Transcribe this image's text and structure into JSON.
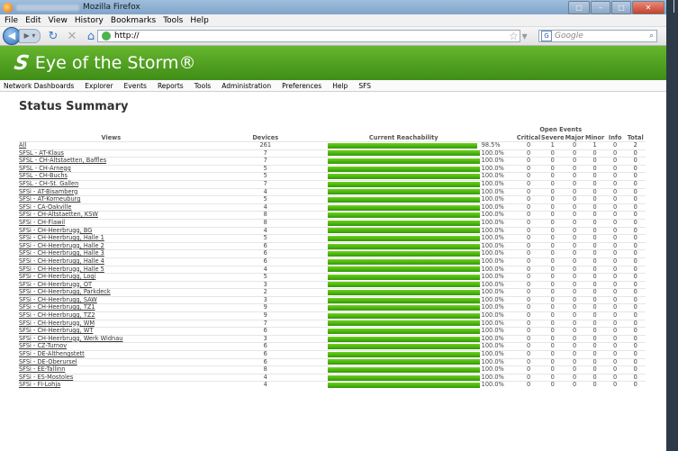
{
  "browser": {
    "title": "Mozilla Firefox",
    "menus": [
      "File",
      "Edit",
      "View",
      "History",
      "Bookmarks",
      "Tools",
      "Help"
    ],
    "url": "http://",
    "search_placeholder": "Google"
  },
  "app": {
    "brand": "Eye of the Storm®",
    "nav": [
      "Network Dashboards",
      "Explorer",
      "Events",
      "Reports",
      "Tools",
      "Administration",
      "Preferences",
      "Help",
      "SFS"
    ]
  },
  "page": {
    "title": "Status Summary"
  },
  "table": {
    "group_header": "Open Events",
    "headers": {
      "views": "Views",
      "devices": "Devices",
      "reach": "Current Reachability",
      "critical": "Critical",
      "severe": "Severe",
      "major": "Major",
      "minor": "Minor",
      "info": "Info",
      "total": "Total"
    },
    "rows": [
      {
        "view": "All",
        "devices": "261",
        "pct": "98.5%",
        "reach": 0.985,
        "critical": "0",
        "severe": "1",
        "major": "0",
        "minor": "1",
        "info": "0",
        "total": "2"
      },
      {
        "view": "SFSL - AT-Klaus",
        "devices": "7",
        "pct": "100.0%",
        "reach": 1,
        "critical": "0",
        "severe": "0",
        "major": "0",
        "minor": "0",
        "info": "0",
        "total": "0"
      },
      {
        "view": "SFSL - CH-Altstaetten, Baffles",
        "devices": "7",
        "pct": "100.0%",
        "reach": 1,
        "critical": "0",
        "severe": "0",
        "major": "0",
        "minor": "0",
        "info": "0",
        "total": "0"
      },
      {
        "view": "SFSL - CH-Arnegg",
        "devices": "5",
        "pct": "100.0%",
        "reach": 1,
        "critical": "0",
        "severe": "0",
        "major": "0",
        "minor": "0",
        "info": "0",
        "total": "0"
      },
      {
        "view": "SFSL - CH-Buchs",
        "devices": "5",
        "pct": "100.0%",
        "reach": 1,
        "critical": "0",
        "severe": "0",
        "major": "0",
        "minor": "0",
        "info": "0",
        "total": "0"
      },
      {
        "view": "SFSL - CH-St. Gallen",
        "devices": "7",
        "pct": "100.0%",
        "reach": 1,
        "critical": "0",
        "severe": "0",
        "major": "0",
        "minor": "0",
        "info": "0",
        "total": "0"
      },
      {
        "view": "SFSi - AT-Bisamberg",
        "devices": "4",
        "pct": "100.0%",
        "reach": 1,
        "critical": "0",
        "severe": "0",
        "major": "0",
        "minor": "0",
        "info": "0",
        "total": "0"
      },
      {
        "view": "SFSi - AT-Korneuburg",
        "devices": "5",
        "pct": "100.0%",
        "reach": 1,
        "critical": "0",
        "severe": "0",
        "major": "0",
        "minor": "0",
        "info": "0",
        "total": "0"
      },
      {
        "view": "SFSi - CA-Oakville",
        "devices": "4",
        "pct": "100.0%",
        "reach": 1,
        "critical": "0",
        "severe": "0",
        "major": "0",
        "minor": "0",
        "info": "0",
        "total": "0"
      },
      {
        "view": "SFSi - CH-Altstaetten, KSW",
        "devices": "8",
        "pct": "100.0%",
        "reach": 1,
        "critical": "0",
        "severe": "0",
        "major": "0",
        "minor": "0",
        "info": "0",
        "total": "0"
      },
      {
        "view": "SFSi - CH-Flawil",
        "devices": "8",
        "pct": "100.0%",
        "reach": 1,
        "critical": "0",
        "severe": "0",
        "major": "0",
        "minor": "0",
        "info": "0",
        "total": "0"
      },
      {
        "view": "SFSi - CH-Heerbrugg, BG",
        "devices": "4",
        "pct": "100.0%",
        "reach": 1,
        "critical": "0",
        "severe": "0",
        "major": "0",
        "minor": "0",
        "info": "0",
        "total": "0"
      },
      {
        "view": "SFSi - CH-Heerbrugg, Halle 1",
        "devices": "5",
        "pct": "100.0%",
        "reach": 1,
        "critical": "0",
        "severe": "0",
        "major": "0",
        "minor": "0",
        "info": "0",
        "total": "0"
      },
      {
        "view": "SFSi - CH-Heerbrugg, Halle 2",
        "devices": "6",
        "pct": "100.0%",
        "reach": 1,
        "critical": "0",
        "severe": "0",
        "major": "0",
        "minor": "0",
        "info": "0",
        "total": "0"
      },
      {
        "view": "SFSi - CH-Heerbrugg, Halle 3",
        "devices": "6",
        "pct": "100.0%",
        "reach": 1,
        "critical": "0",
        "severe": "0",
        "major": "0",
        "minor": "0",
        "info": "0",
        "total": "0"
      },
      {
        "view": "SFSi - CH-Heerbrugg, Halle 4",
        "devices": "6",
        "pct": "100.0%",
        "reach": 1,
        "critical": "0",
        "severe": "0",
        "major": "0",
        "minor": "0",
        "info": "0",
        "total": "0"
      },
      {
        "view": "SFSi - CH-Heerbrugg, Halle 5",
        "devices": "4",
        "pct": "100.0%",
        "reach": 1,
        "critical": "0",
        "severe": "0",
        "major": "0",
        "minor": "0",
        "info": "0",
        "total": "0"
      },
      {
        "view": "SFSi - CH-Heerbrugg, Logi",
        "devices": "5",
        "pct": "100.0%",
        "reach": 1,
        "critical": "0",
        "severe": "0",
        "major": "0",
        "minor": "0",
        "info": "0",
        "total": "0"
      },
      {
        "view": "SFSi - CH-Heerbrugg, OT",
        "devices": "3",
        "pct": "100.0%",
        "reach": 1,
        "critical": "0",
        "severe": "0",
        "major": "0",
        "minor": "0",
        "info": "0",
        "total": "0"
      },
      {
        "view": "SFSi - CH-Heerbrugg, Parkdeck",
        "devices": "2",
        "pct": "100.0%",
        "reach": 1,
        "critical": "0",
        "severe": "0",
        "major": "0",
        "minor": "0",
        "info": "0",
        "total": "0"
      },
      {
        "view": "SFSi - CH-Heerbrugg, SAW",
        "devices": "3",
        "pct": "100.0%",
        "reach": 1,
        "critical": "0",
        "severe": "0",
        "major": "0",
        "minor": "0",
        "info": "0",
        "total": "0"
      },
      {
        "view": "SFSi - CH-Heerbrugg, TZ1",
        "devices": "9",
        "pct": "100.0%",
        "reach": 1,
        "critical": "0",
        "severe": "0",
        "major": "0",
        "minor": "0",
        "info": "0",
        "total": "0"
      },
      {
        "view": "SFSi - CH-Heerbrugg, TZ2",
        "devices": "9",
        "pct": "100.0%",
        "reach": 1,
        "critical": "0",
        "severe": "0",
        "major": "0",
        "minor": "0",
        "info": "0",
        "total": "0"
      },
      {
        "view": "SFSi - CH-Heerbrugg, WM",
        "devices": "7",
        "pct": "100.0%",
        "reach": 1,
        "critical": "0",
        "severe": "0",
        "major": "0",
        "minor": "0",
        "info": "0",
        "total": "0"
      },
      {
        "view": "SFSi - CH-Heerbrugg, WT",
        "devices": "6",
        "pct": "100.0%",
        "reach": 1,
        "critical": "0",
        "severe": "0",
        "major": "0",
        "minor": "0",
        "info": "0",
        "total": "0"
      },
      {
        "view": "SFSi - CH-Heerbrugg, Werk Widnau",
        "devices": "3",
        "pct": "100.0%",
        "reach": 1,
        "critical": "0",
        "severe": "0",
        "major": "0",
        "minor": "0",
        "info": "0",
        "total": "0"
      },
      {
        "view": "SFSi - CZ-Turnov",
        "devices": "6",
        "pct": "100.0%",
        "reach": 1,
        "critical": "0",
        "severe": "0",
        "major": "0",
        "minor": "0",
        "info": "0",
        "total": "0"
      },
      {
        "view": "SFSi - DE-Althengstett",
        "devices": "6",
        "pct": "100.0%",
        "reach": 1,
        "critical": "0",
        "severe": "0",
        "major": "0",
        "minor": "0",
        "info": "0",
        "total": "0"
      },
      {
        "view": "SFSi - DE-Oberursel",
        "devices": "6",
        "pct": "100.0%",
        "reach": 1,
        "critical": "0",
        "severe": "0",
        "major": "0",
        "minor": "0",
        "info": "0",
        "total": "0"
      },
      {
        "view": "SFSi - EE-Tallinn",
        "devices": "8",
        "pct": "100.0%",
        "reach": 1,
        "critical": "0",
        "severe": "0",
        "major": "0",
        "minor": "0",
        "info": "0",
        "total": "0"
      },
      {
        "view": "SFSi - ES-Mostoles",
        "devices": "4",
        "pct": "100.0%",
        "reach": 1,
        "critical": "0",
        "severe": "0",
        "major": "0",
        "minor": "0",
        "info": "0",
        "total": "0"
      },
      {
        "view": "SFSi - FI-Lohja",
        "devices": "4",
        "pct": "100.0%",
        "reach": 1,
        "critical": "0",
        "severe": "0",
        "major": "0",
        "minor": "0",
        "info": "0",
        "total": "0"
      }
    ]
  }
}
